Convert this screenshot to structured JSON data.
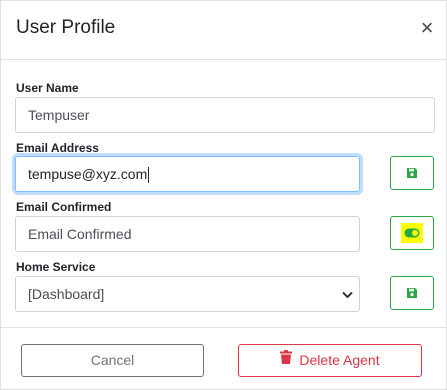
{
  "dialog": {
    "title": "User Profile",
    "close_label": "×"
  },
  "fields": {
    "user_name": {
      "label": "User Name",
      "value": "Tempuser"
    },
    "email": {
      "label": "Email Address",
      "value": "tempuse@xyz.com"
    },
    "email_confirmed": {
      "label": "Email Confirmed",
      "value": "Email Confirmed"
    },
    "home_service": {
      "label": "Home Service",
      "value": "[Dashboard]"
    }
  },
  "footer": {
    "cancel_label": "Cancel",
    "delete_label": "Delete Agent"
  },
  "icons": {
    "save": "save-icon",
    "toggle": "toggle-on-icon",
    "trash": "trash-icon",
    "chevron": "chevron-down-icon"
  },
  "colors": {
    "success": "#28a745",
    "danger": "#dc3545",
    "secondary": "#6c757d",
    "highlight": "#ffff00"
  }
}
